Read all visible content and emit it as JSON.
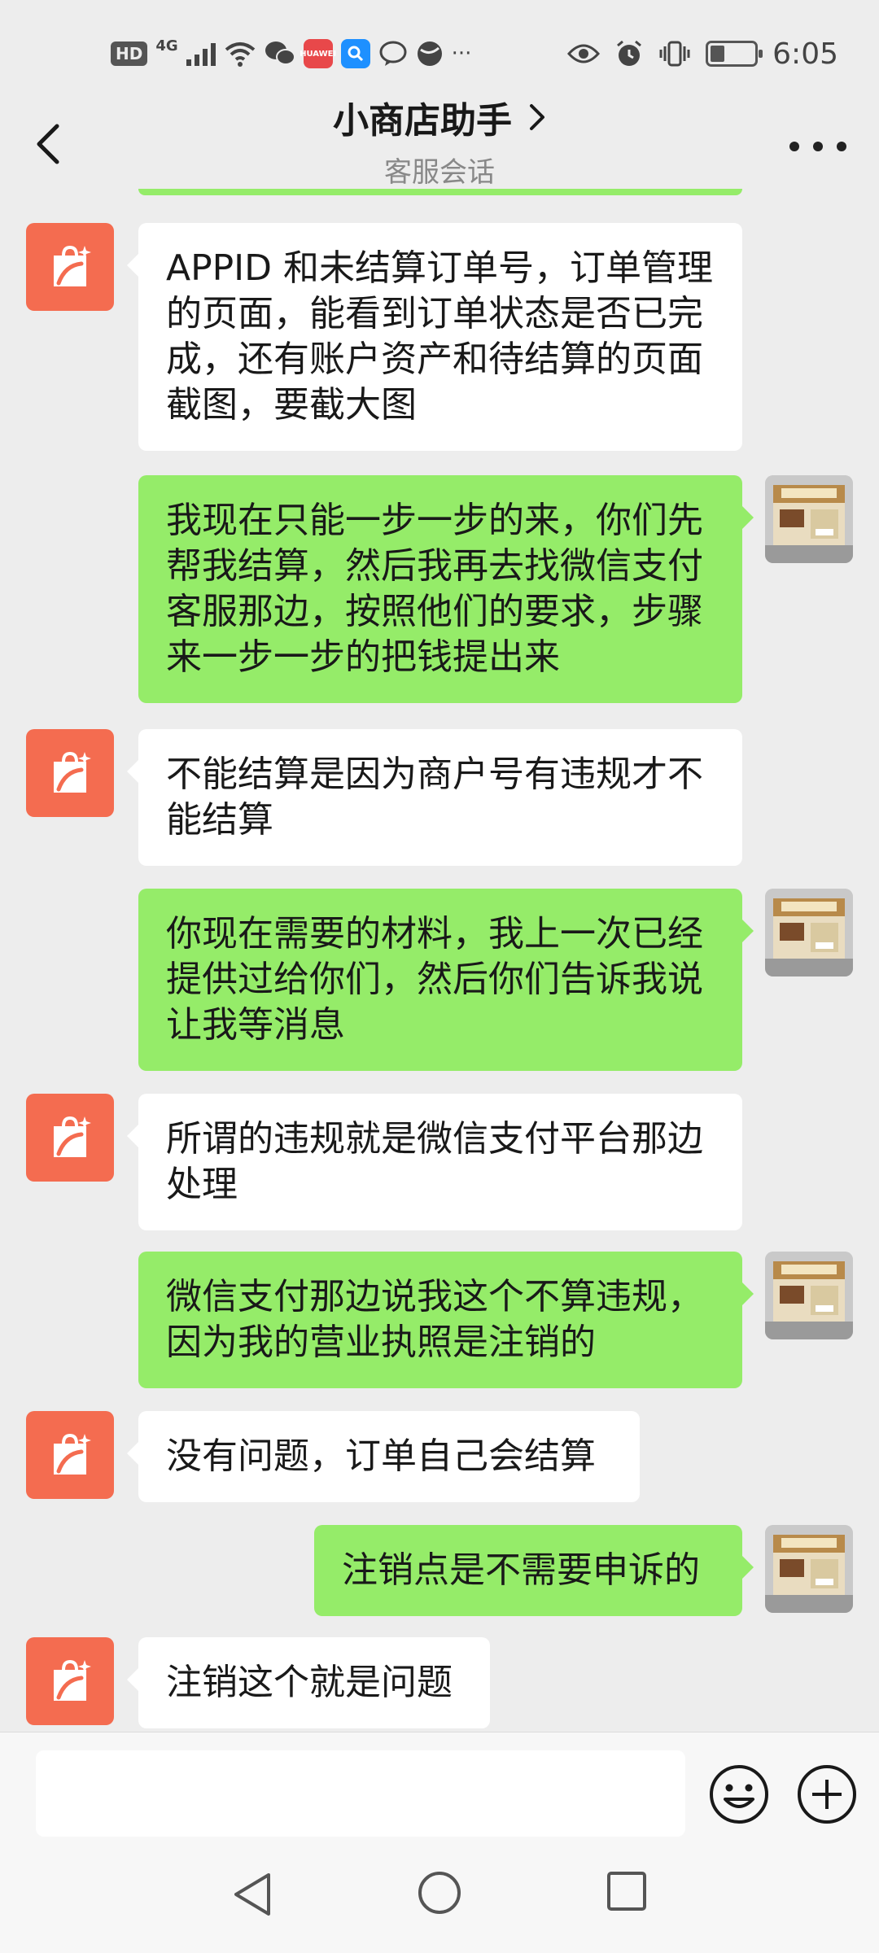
{
  "status_bar": {
    "hd_badge": "HD",
    "network": "4G",
    "app_badge": "HUAWEI",
    "time": "6:05",
    "more_dots": "···"
  },
  "header": {
    "title": "小商店助手",
    "subtitle": "客服会话"
  },
  "messages": [
    {
      "from": "shop",
      "text": "APPID 和未结算订单号，订单管理的页面，能看到订单状态是否已完成，还有账户资产和待结算的页面截图，要截大图"
    },
    {
      "from": "user",
      "text": "我现在只能一步一步的来，你们先帮我结算，然后我再去找微信支付客服那边，按照他们的要求，步骤来一步一步的把钱提出来"
    },
    {
      "from": "shop",
      "text": "不能结算是因为商户号有违规才不能结算"
    },
    {
      "from": "user",
      "text": "你现在需要的材料，我上一次已经提供过给你们，然后你们告诉我说让我等消息"
    },
    {
      "from": "shop",
      "text": "所谓的违规就是微信支付平台那边处理"
    },
    {
      "from": "user",
      "text": "微信支付那边说我这个不算违规，因为我的营业执照是注销的"
    },
    {
      "from": "shop",
      "text": "没有问题，订单自己会结算"
    },
    {
      "from": "user",
      "text": "注销点是不需要申诉的"
    },
    {
      "from": "shop",
      "text": "注销这个就是问题"
    }
  ],
  "input": {
    "value": ""
  },
  "colors": {
    "background": "#ededed",
    "outgoing_bubble": "#95ec69",
    "incoming_bubble": "#ffffff",
    "shop_avatar": "#f46c50"
  },
  "icons": {
    "back": "chevron-left-icon",
    "title_chevron": "chevron-right-icon",
    "more": "more-dots-icon",
    "shop_avatar": "shopping-bag-sparkle-icon",
    "user_avatar": "storefront-photo",
    "emoji": "smiley-icon",
    "plus": "plus-circle-icon",
    "nav_back": "triangle-back-icon",
    "nav_home": "circle-home-icon",
    "nav_recent": "square-recent-icon"
  }
}
